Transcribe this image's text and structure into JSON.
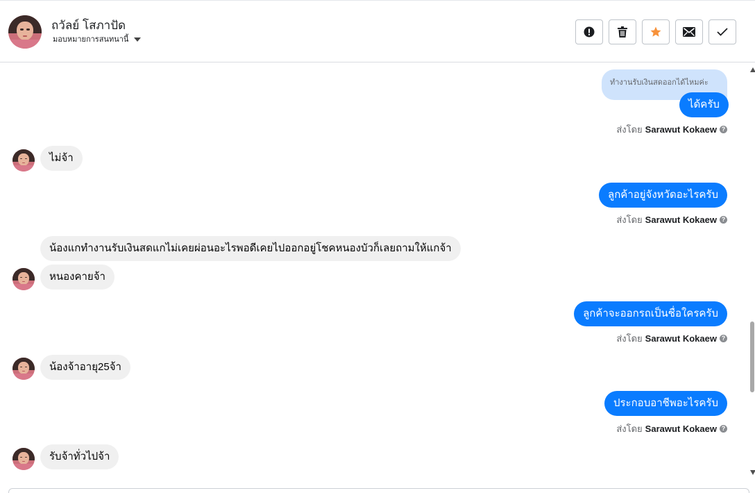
{
  "header": {
    "contact_name": "ถวัลย์ โสภาปัด",
    "assign_label": "มอบหมายการสนทนานี้",
    "actions": [
      {
        "name": "spam-icon"
      },
      {
        "name": "trash-icon"
      },
      {
        "name": "star-icon"
      },
      {
        "name": "mail-icon"
      },
      {
        "name": "check-icon"
      }
    ],
    "star_color": "#f7923b"
  },
  "messages": {
    "m1_quote": "ทำงานรับเงินสดออกได้ไหมค่ะ",
    "m1_reply": "ได้ครับ",
    "sent_prefix": "ส่งโดย",
    "sender": "Sarawut Kokaew",
    "m2": "ไม่จ้า",
    "m3": "ลูกค้าอยู่จังหวัดอะไรครับ",
    "m4a": "น้องแกทำงานรับเงินสดแกไม่เคยผ่อนอะไรพอดีเคยไปออกอยู่โชคหนองบัวก็เลยถามให้แกจ้า",
    "m4b": "หนองคายจ้า",
    "m5": "ลูกค้าจะออกรถเป็นชื่อใครครับ",
    "m6": "น้องจ้าอายุ25จ้า",
    "m7": "ประกอบอาชีพอะไรครับ",
    "m8": "รับจ้าทั่วไปจ้า"
  },
  "colors": {
    "outgoing": "#0a7cff",
    "incoming": "#f0f0f0",
    "quote": "#cfe3fc"
  }
}
